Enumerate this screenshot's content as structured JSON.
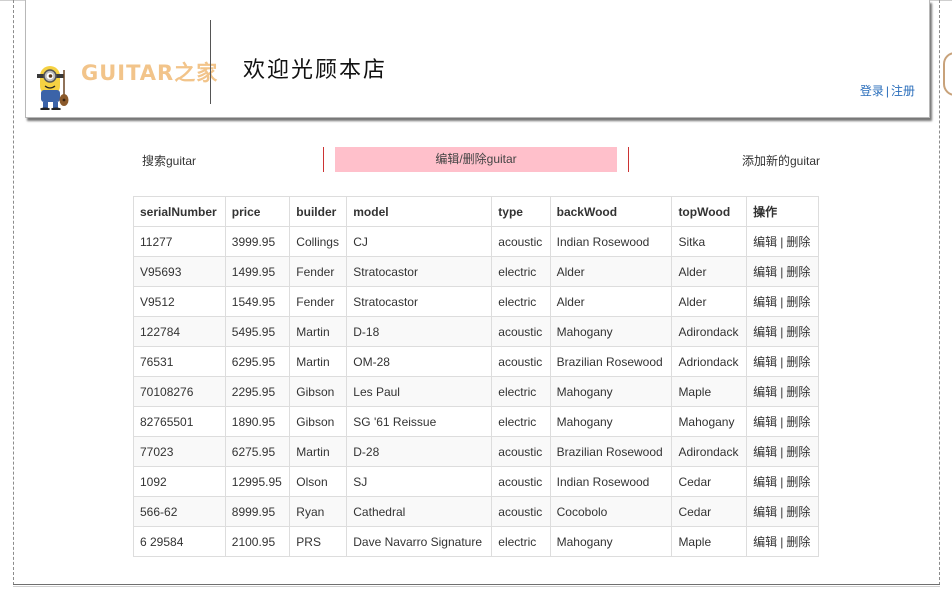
{
  "header": {
    "logo_text": "GUITAR之家",
    "welcome": "欢迎光顾本店",
    "login": "登录",
    "register": "注册",
    "separator": "|"
  },
  "nav": {
    "search": "搜索guitar",
    "edit": "编辑/删除guitar",
    "add": "添加新的guitar",
    "active_color": "#ffc0cb"
  },
  "table": {
    "headers": [
      "serialNumber",
      "price",
      "builder",
      "model",
      "type",
      "backWood",
      "topWood",
      "操作"
    ],
    "edit_label": "编辑",
    "delete_label": "删除",
    "rows": [
      [
        "11277",
        "3999.95",
        "Collings",
        "CJ",
        "acoustic",
        "Indian Rosewood",
        "Sitka"
      ],
      [
        "V95693",
        "1499.95",
        "Fender",
        "Stratocastor",
        "electric",
        "Alder",
        "Alder"
      ],
      [
        "V9512",
        "1549.95",
        "Fender",
        "Stratocastor",
        "electric",
        "Alder",
        "Alder"
      ],
      [
        "122784",
        "5495.95",
        "Martin",
        "D-18",
        "acoustic",
        "Mahogany",
        "Adirondack"
      ],
      [
        "76531",
        "6295.95",
        "Martin",
        "OM-28",
        "acoustic",
        "Brazilian Rosewood",
        "Adriondack"
      ],
      [
        "70108276",
        "2295.95",
        "Gibson",
        "Les Paul",
        "electric",
        "Mahogany",
        "Maple"
      ],
      [
        "82765501",
        "1890.95",
        "Gibson",
        "SG '61 Reissue",
        "electric",
        "Mahogany",
        "Mahogany"
      ],
      [
        "77023",
        "6275.95",
        "Martin",
        "D-28",
        "acoustic",
        "Brazilian Rosewood",
        "Adirondack"
      ],
      [
        "1092",
        "12995.95",
        "Olson",
        "SJ",
        "acoustic",
        "Indian Rosewood",
        "Cedar"
      ],
      [
        "566-62",
        "8999.95",
        "Ryan",
        "Cathedral",
        "acoustic",
        "Cocobolo",
        "Cedar"
      ],
      [
        "6 29584",
        "2100.95",
        "PRS",
        "Dave Navarro Signature",
        "electric",
        "Mahogany",
        "Maple"
      ]
    ]
  }
}
